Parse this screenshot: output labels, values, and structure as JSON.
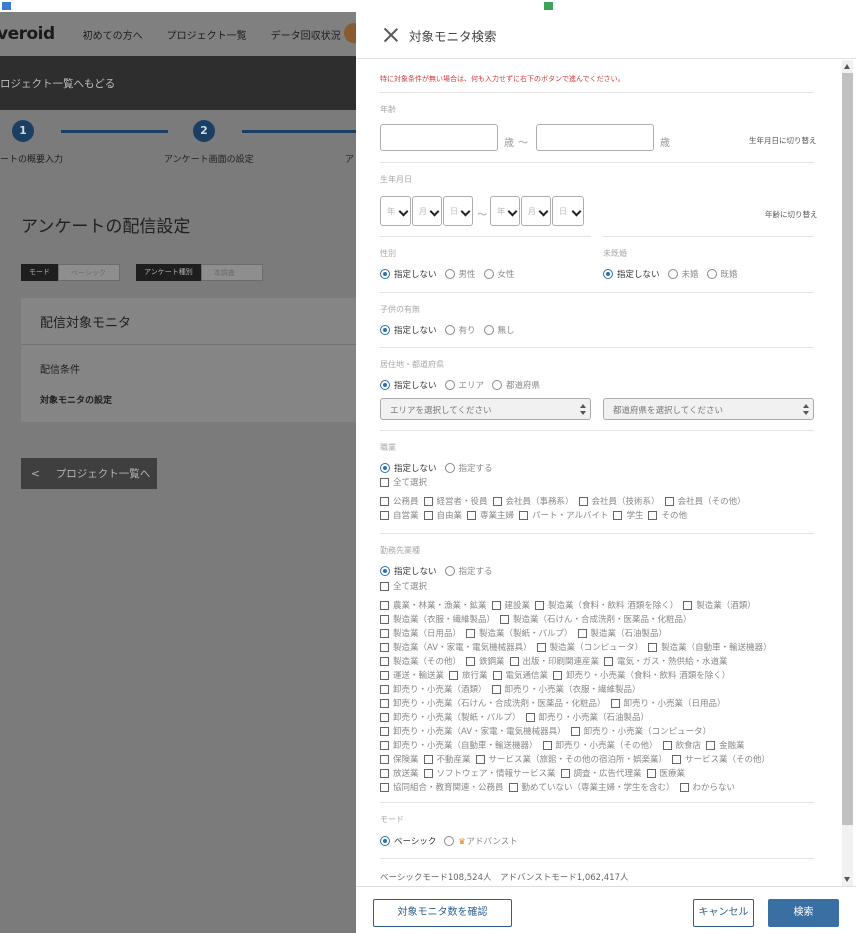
{
  "background": {
    "logo": "veroid",
    "nav": [
      "初めての方へ",
      "プロジェクト一覧",
      "データ回収状況"
    ],
    "back_link": "ロジェクト一覧へもどる",
    "steps": [
      {
        "num": "1",
        "label": "ートの概要入力"
      },
      {
        "num": "2",
        "label": "アンケート画面の設定"
      },
      {
        "label": "ア"
      }
    ],
    "page_title": "アンケートの配信設定",
    "mode_label": "モード",
    "mode_value": "ベーシック",
    "type_label": "アンケート種別",
    "type_value": "本調査",
    "card": {
      "title": "配信対象モニタ",
      "row1": "配信条件",
      "row2": "対象モニタの設定"
    },
    "back_button": "プロジェクト一覧へ"
  },
  "modal": {
    "title": "対象モニタ検索",
    "note": "特に対象条件が無い場合は、何も入力せずに右下のボタンで進んでください。",
    "age": {
      "label": "年齢",
      "unit": "歳",
      "tilde": "～",
      "switch_link": "生年月日に切り替え"
    },
    "birth": {
      "label": "生年月日",
      "year": "年",
      "month": "月",
      "day": "日",
      "tilde": "～",
      "switch_link": "年齢に切り替え"
    },
    "gender": {
      "label": "性別",
      "options": [
        "指定しない",
        "男性",
        "女性"
      ]
    },
    "marital": {
      "label": "未既婚",
      "options": [
        "指定しない",
        "未婚",
        "既婚"
      ]
    },
    "children": {
      "label": "子供の有無",
      "options": [
        "指定しない",
        "有り",
        "無し"
      ]
    },
    "residence": {
      "label": "居住地・都道府県",
      "options": [
        "指定しない",
        "エリア",
        "都道府県"
      ],
      "area_placeholder": "エリアを選択してください",
      "pref_placeholder": "都道府県を選択してください"
    },
    "occupation": {
      "label": "職業",
      "options": [
        "指定しない",
        "指定する"
      ],
      "select_all": "全て選択",
      "rows": [
        [
          "公務員",
          "経営者・役員",
          "会社員（事務系）",
          "会社員（技術系）",
          "会社員（その他）"
        ],
        [
          "自営業",
          "自由業",
          "専業主婦",
          "パート・アルバイト",
          "学生",
          "その他"
        ]
      ]
    },
    "industry": {
      "label": "勤務先業種",
      "options": [
        "指定しない",
        "指定する"
      ],
      "select_all": "全て選択",
      "rows": [
        [
          "農業・林業・漁業・鉱業",
          "建設業",
          "製造業（食料・飲料 酒類を除く）",
          "製造業（酒類）"
        ],
        [
          "製造業（衣服・繊維製品）",
          "製造業（石けん・合成洗剤・医薬品・化粧品）"
        ],
        [
          "製造業（日用品）",
          "製造業（製紙・パルプ）",
          "製造業（石油製品）"
        ],
        [
          "製造業（AV・家電・電気機械器具）",
          "製造業（コンピュータ）",
          "製造業（自動車・輸送機器）"
        ],
        [
          "製造業（その他）",
          "鉄鋼業",
          "出版・印刷関連産業",
          "電気・ガス・熱供給・水道業"
        ],
        [
          "運送・輸送業",
          "旅行業",
          "電気通信業",
          "卸売り・小売業（食料・飲料 酒類を除く）"
        ],
        [
          "卸売り・小売業（酒類）",
          "卸売り・小売業（衣服・繊維製品）"
        ],
        [
          "卸売り・小売業（石けん・合成洗剤・医薬品・化粧品）",
          "卸売り・小売業（日用品）"
        ],
        [
          "卸売り・小売業（製紙・パルプ）",
          "卸売り・小売業（石油製品）"
        ],
        [
          "卸売り・小売業（AV・家電・電気機械器具）",
          "卸売り・小売業（コンピュータ）"
        ],
        [
          "卸売り・小売業（自動車・輸送機器）",
          "卸売り・小売業（その他）",
          "飲食店",
          "金融業"
        ],
        [
          "保険業",
          "不動産業",
          "サービス業（旅館・その他の宿泊所・娯楽業）",
          "サービス業（その他）"
        ],
        [
          "放送業",
          "ソフトウェア・情報サービス業",
          "調査・広告代理業",
          "医療業"
        ],
        [
          "協同組合・教育関連・公務員",
          "勤めていない（専業主婦・学生を含む）",
          "わからない"
        ]
      ]
    },
    "mode": {
      "label": "モード",
      "options": [
        "ベーシック",
        "アドバンスト"
      ],
      "counts": "ベーシックモード108,524人　アドバンストモード1,062,417人"
    },
    "footer": {
      "confirm": "対象モニタ数を確認",
      "cancel": "キャンセル",
      "search": "検索"
    }
  },
  "colors": {
    "accent": "#2f6fad",
    "note_red": "#d63a3a",
    "dark_bg": "#2e2e2e"
  }
}
